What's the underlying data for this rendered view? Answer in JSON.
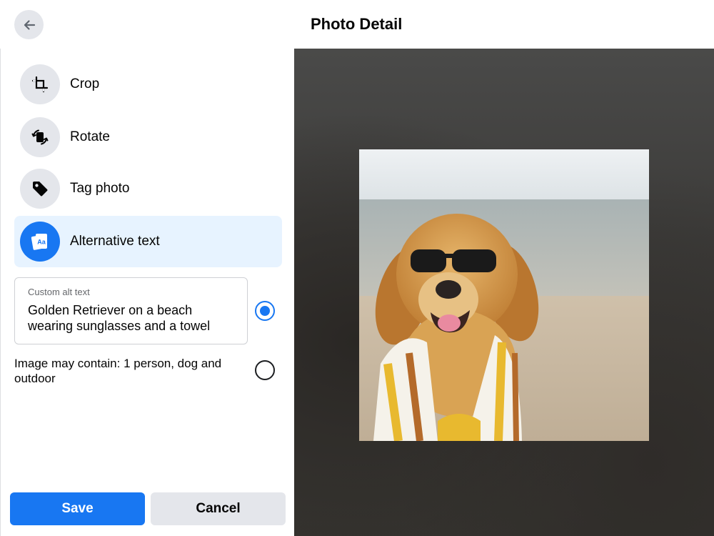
{
  "header": {
    "title": "Photo Detail",
    "back_icon": "arrow-left-icon"
  },
  "menu": {
    "items": [
      {
        "label": "Crop",
        "icon": "crop-icon",
        "active": false
      },
      {
        "label": "Rotate",
        "icon": "rotate-icon",
        "active": false
      },
      {
        "label": "Tag photo",
        "icon": "tag-icon",
        "active": false
      },
      {
        "label": "Alternative text",
        "icon": "alt-text-icon",
        "active": true
      }
    ]
  },
  "alt_text": {
    "custom_label": "Custom alt text",
    "custom_value_line1": "Golden Retriever on a beach",
    "custom_value_line2": "wearing sunglasses and a towel",
    "custom_selected": true,
    "suggestion_line1": "Image may contain: 1 person, dog and",
    "suggestion_line2": "outdoor",
    "suggestion_selected": false
  },
  "actions": {
    "save_label": "Save",
    "cancel_label": "Cancel"
  },
  "colors": {
    "accent": "#1877f2",
    "active_bg": "#e7f3ff",
    "icon_bg": "#e4e6eb"
  }
}
